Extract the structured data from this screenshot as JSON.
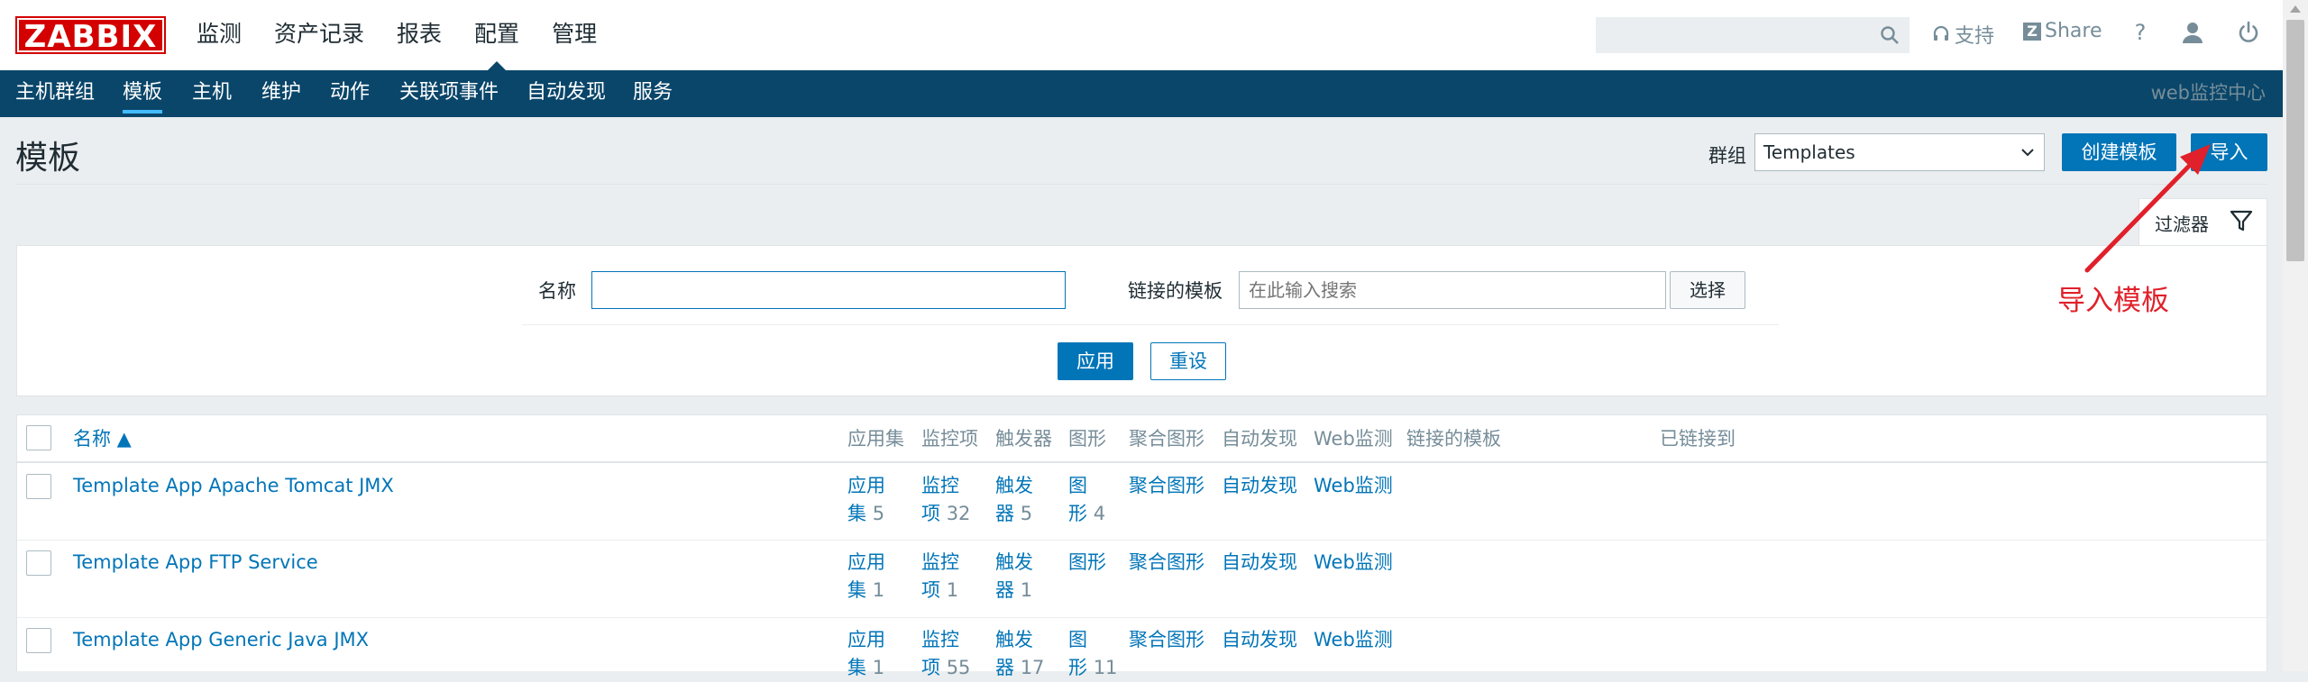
{
  "header": {
    "logo": "ZABBIX",
    "nav": [
      "监测",
      "资产记录",
      "报表",
      "配置",
      "管理"
    ],
    "active_nav": 3,
    "support": "支持",
    "share": "Share",
    "help": "?",
    "icons": [
      "search-icon",
      "headset-icon",
      "zabbix-share-icon",
      "help-icon",
      "user-icon",
      "power-icon"
    ]
  },
  "subnav": {
    "items": [
      "主机群组",
      "模板",
      "主机",
      "维护",
      "动作",
      "关联项事件",
      "自动发现",
      "服务"
    ],
    "active": 1,
    "right_text": "web监控中心"
  },
  "page": {
    "title": "模板",
    "group_label": "群组",
    "group_value": "Templates",
    "create_button": "创建模板",
    "import_button": "导入"
  },
  "filter": {
    "tab_label": "过滤器",
    "name_label": "名称",
    "name_value": "",
    "linked_label": "链接的模板",
    "linked_placeholder": "在此输入搜索",
    "select_button": "选择",
    "apply_button": "应用",
    "reset_button": "重设"
  },
  "table": {
    "headers": {
      "name": "名称 ▲",
      "applications": "应用集",
      "items": "监控项",
      "triggers": "触发器",
      "graphs": "图形",
      "screens": "聚合图形",
      "discovery": "自动发现",
      "web": "Web监测",
      "linked_templates": "链接的模板",
      "linked_to": "已链接到"
    },
    "rows": [
      {
        "name": "Template App Apache Tomcat JMX",
        "app_l1": "应用",
        "app_l2": "集",
        "app_count": "5",
        "item_l1": "监控",
        "item_l2": "项",
        "item_count": "32",
        "trig_l1": "触发",
        "trig_l2": "器",
        "trig_count": "5",
        "graph_l1": "图",
        "graph_l2": "形",
        "graph_count": "4",
        "screens": "聚合图形",
        "discovery": "自动发现",
        "web": "Web监测"
      },
      {
        "name": "Template App FTP Service",
        "app_l1": "应用",
        "app_l2": "集",
        "app_count": "1",
        "item_l1": "监控",
        "item_l2": "项",
        "item_count": "1",
        "trig_l1": "触发",
        "trig_l2": "器",
        "trig_count": "1",
        "graph_l1": "图形",
        "graph_l2": "",
        "graph_count": "",
        "screens": "聚合图形",
        "discovery": "自动发现",
        "web": "Web监测"
      },
      {
        "name": "Template App Generic Java JMX",
        "app_l1": "应用",
        "app_l2": "集",
        "app_count": "1",
        "item_l1": "监控",
        "item_l2": "项",
        "item_count": "55",
        "trig_l1": "触发",
        "trig_l2": "器",
        "trig_count": "17",
        "graph_l1": "图",
        "graph_l2": "形",
        "graph_count": "11",
        "screens": "聚合图形",
        "discovery": "自动发现",
        "web": "Web监测"
      }
    ]
  },
  "annotation": {
    "text": "导入模板",
    "color": "#e0202a"
  },
  "colors": {
    "brand": "#d40000",
    "nav_dark": "#0a466a",
    "link": "#0275b8",
    "muted": "#768d99"
  }
}
